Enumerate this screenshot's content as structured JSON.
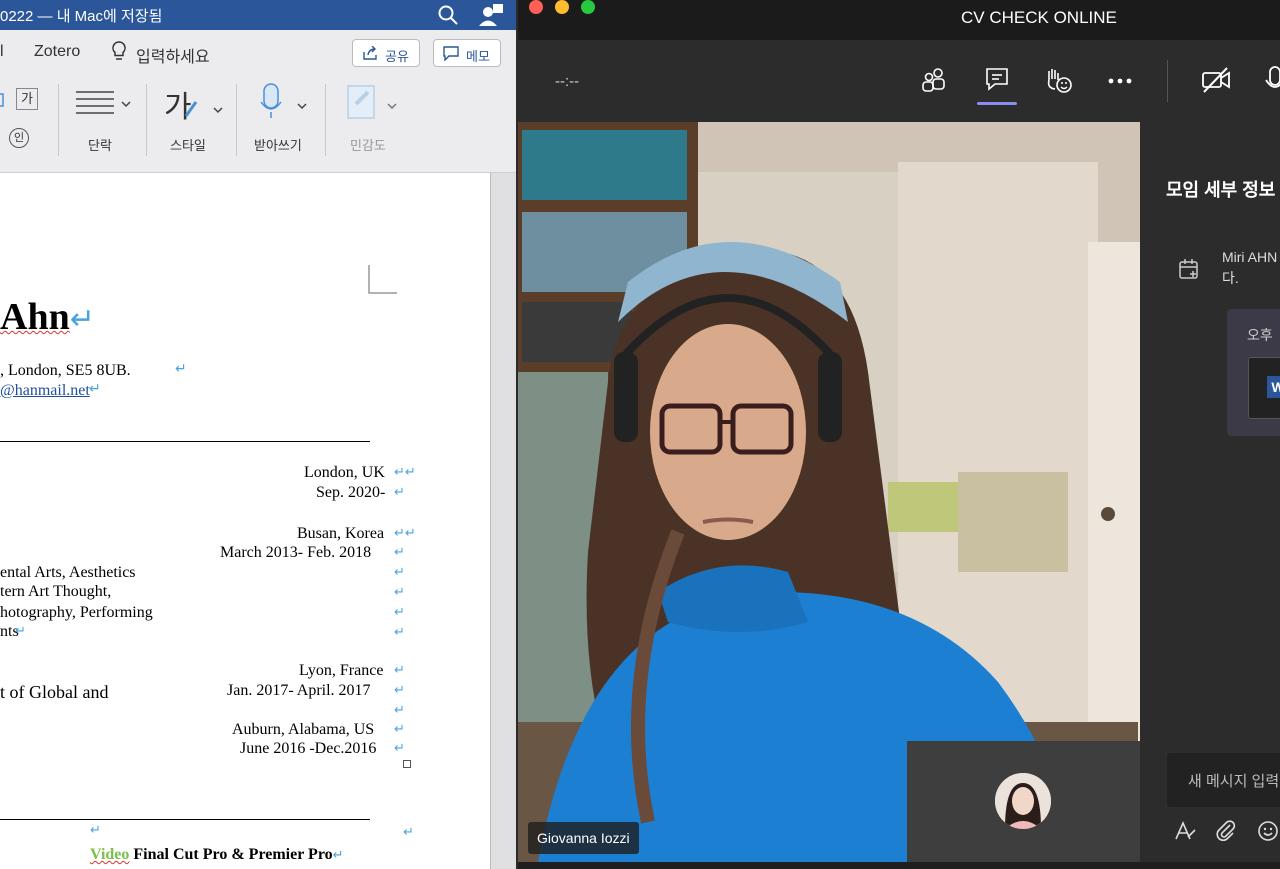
{
  "word": {
    "title": "0222 — 내 Mac에 저장됨",
    "tabs": {
      "partial": "l",
      "zotero": "Zotero",
      "tell_me": "입력하세요"
    },
    "share_label": "공유",
    "memo_label": "메모",
    "ribbon": {
      "font_glyph": "가",
      "circle_glyph": "인",
      "paragraph": "단락",
      "styles": "스타일",
      "dictate": "받아쓰기",
      "sensitivity": "민감도",
      "style_glyph": "가"
    },
    "document": {
      "name": "Ahn",
      "address": ", London, SE5 8UB.",
      "email": "@hanmail.net",
      "entries": [
        {
          "location": "London, UK",
          "dates": "Sep. 2020-"
        },
        {
          "location": "Busan, Korea",
          "dates": "March 2013- Feb. 2018"
        },
        {
          "location": "Lyon, France",
          "dates": "Jan. 2017- April. 2017"
        },
        {
          "location": "Auburn, Alabama, US",
          "dates": "June 2016 -Dec.2016"
        }
      ],
      "lines": [
        "ental Arts, Aesthetics",
        "tern Art Thought,",
        "hotography, Performing",
        "nts"
      ],
      "global_line": "t of Global and",
      "skills_label": "Video",
      "skills_text": "Final Cut Pro & Premier Pro"
    }
  },
  "teams": {
    "meeting_title": "CV CHECK ONLINE",
    "timer": "--:--",
    "participant_name": "Giovanna Iozzi",
    "panel": {
      "title": "모임 세부 정보",
      "organizer_line1": "Miri AHN",
      "organizer_line2": "다.",
      "card_time": "오후",
      "compose_placeholder": "새 메시지 입력"
    },
    "colors": {
      "accent": "#8b8cf0",
      "toolbar": "#2d2c2c",
      "word_blue": "#2b579a"
    }
  }
}
